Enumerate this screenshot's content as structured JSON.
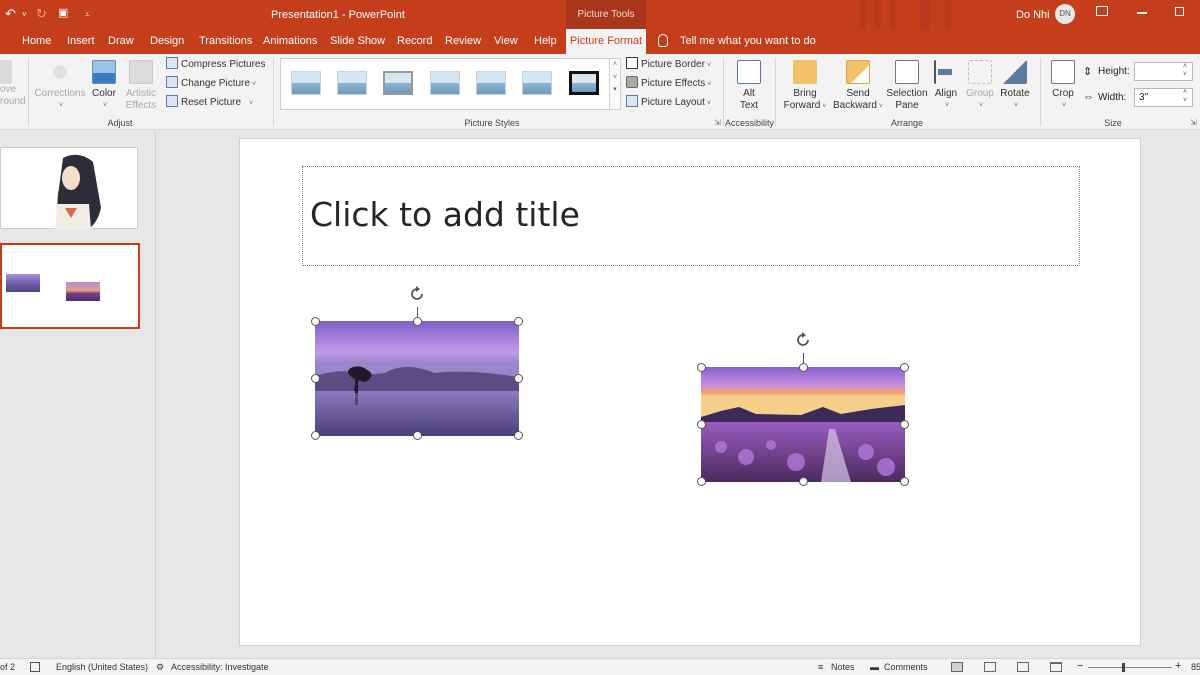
{
  "window": {
    "title": "Presentation1  -  PowerPoint",
    "contextual_group": "Picture Tools",
    "user_name": "Do Nhi",
    "user_initials": "DN"
  },
  "tabs": [
    "Home",
    "Insert",
    "Draw",
    "Design",
    "Transitions",
    "Animations",
    "Slide Show",
    "Record",
    "Review",
    "View",
    "Help"
  ],
  "active_tab": "Picture Format",
  "tell_me": "Tell me what you want to do",
  "ribbon": {
    "adjust": {
      "remove_bg_partial_1": "ove",
      "remove_bg_partial_2": "round",
      "corrections": "Corrections",
      "color": "Color",
      "artistic_1": "Artistic",
      "artistic_2": "Effects",
      "compress": "Compress Pictures",
      "change": "Change Picture",
      "reset": "Reset Picture",
      "label": "Adjust"
    },
    "picture_styles": {
      "border": "Picture Border",
      "effects": "Picture Effects",
      "layout": "Picture Layout",
      "label": "Picture Styles"
    },
    "accessibility": {
      "alt_1": "Alt",
      "alt_2": "Text",
      "label": "Accessibility"
    },
    "arrange": {
      "bring_1": "Bring",
      "bring_2": "Forward",
      "send_1": "Send",
      "send_2": "Backward",
      "selection_1": "Selection",
      "selection_2": "Pane",
      "align": "Align",
      "group": "Group",
      "rotate": "Rotate",
      "label": "Arrange"
    },
    "size": {
      "crop": "Crop",
      "height_label": "Height:",
      "height_value": "",
      "width_label": "Width:",
      "width_value": "3\"",
      "label": "Size"
    }
  },
  "slide": {
    "title_placeholder": "Click to add title"
  },
  "statusbar": {
    "slide_count_partial": "of 2",
    "language": "English (United States)",
    "accessibility": "Accessibility: Investigate",
    "notes": "Notes",
    "comments": "Comments",
    "zoom_minus": "−",
    "zoom_plus": "+",
    "zoom_partial": "85"
  },
  "colors": {
    "accent": "#c43e1c",
    "ribbon_bg": "#f3f3f3",
    "selection_thumb_border": "#c43e1c"
  }
}
